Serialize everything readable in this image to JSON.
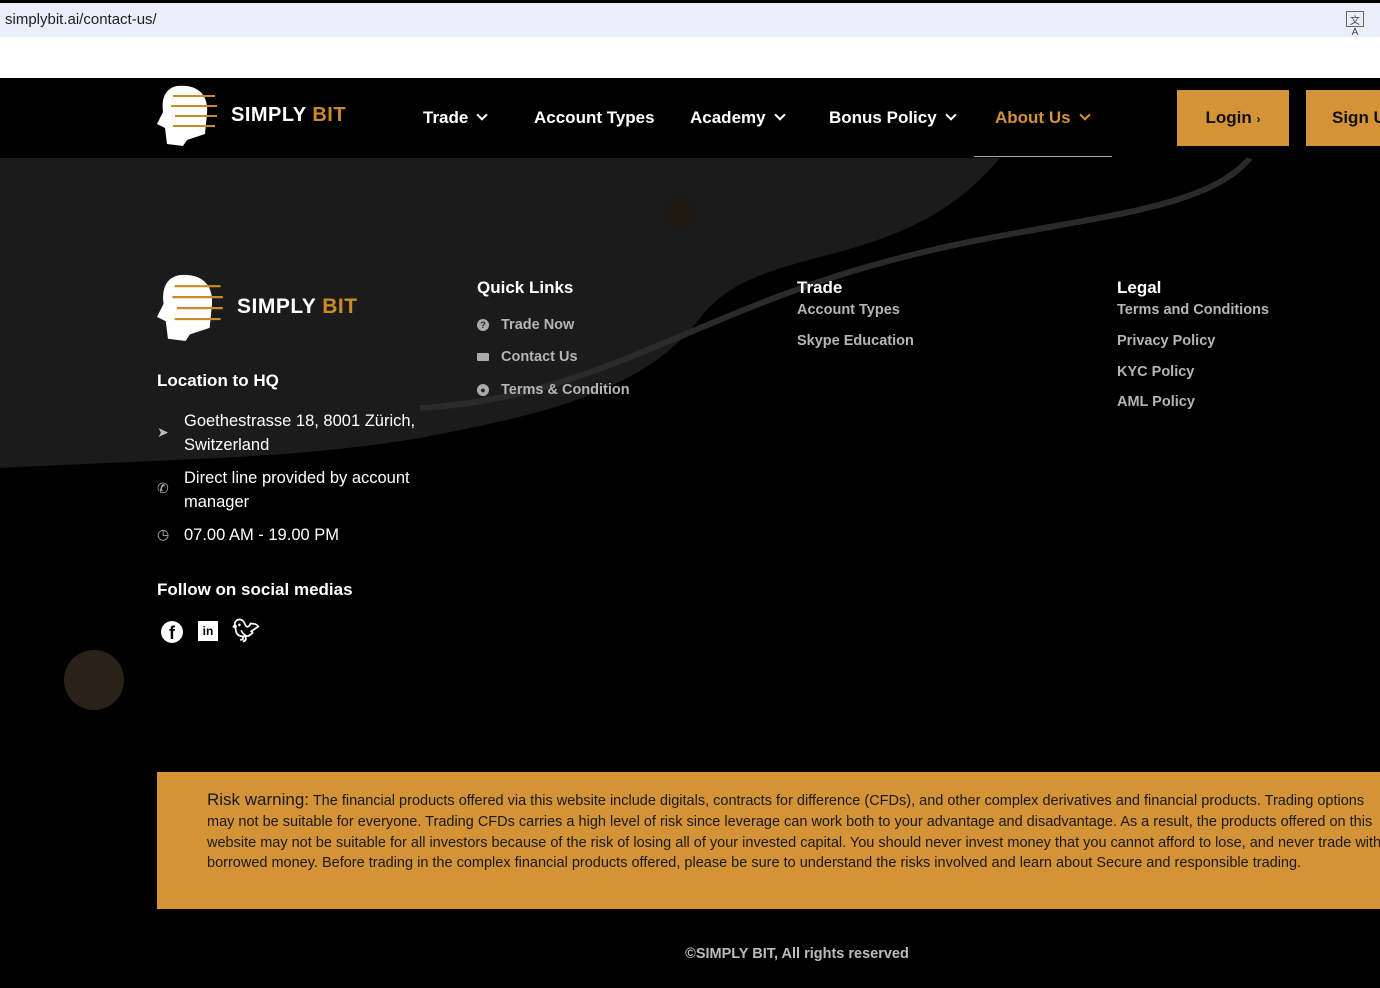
{
  "browser": {
    "url": "simplybit.ai/contact-us/",
    "translate_icon": "translate-icon"
  },
  "brand": {
    "simply": "SIMPLY",
    "bit": "BIT"
  },
  "nav": {
    "items": [
      {
        "label": "Trade"
      },
      {
        "label": "Account Types"
      },
      {
        "label": "Academy"
      },
      {
        "label": "Bonus Policy"
      },
      {
        "label": "About Us"
      }
    ],
    "login": "Login",
    "signup": "Sign Up"
  },
  "colors": {
    "accent": "#d39336"
  },
  "footer": {
    "location_heading": "Location to HQ",
    "address": "Goethestrasse 18, 8001 Zürich, Switzerland",
    "phone": "Direct line provided by account manager",
    "hours": "07.00 AM - 19.00 PM",
    "social_heading": "Follow on social medias",
    "quick_links": {
      "heading": "Quick Links",
      "items": [
        "Trade Now",
        "Contact Us",
        "Terms & Condition"
      ]
    },
    "trade": {
      "heading": "Trade",
      "items": [
        "Account Types",
        "Skype Education"
      ]
    },
    "legal": {
      "heading": "Legal",
      "items": [
        "Terms and Conditions",
        "Privacy Policy",
        "KYC Policy",
        "AML Policy"
      ]
    }
  },
  "risk": {
    "label": "Risk warning:",
    "text": " The financial products offered via this website include digitals, contracts for difference (CFDs), and other complex derivatives and financial products. Trading options may not be suitable for everyone. Trading CFDs carries a high level of risk since leverage can work both to your advantage and disadvantage. As a result, the products offered on this website may not be suitable for all investors because of the risk of losing all of your invested capital. You should never invest money that you cannot afford to lose, and never trade with borrowed money. Before trading in the complex financial products offered, please be sure to understand the risks involved and learn about Secure and responsible trading."
  },
  "copyright": "©SIMPLY BIT, All rights reserved"
}
